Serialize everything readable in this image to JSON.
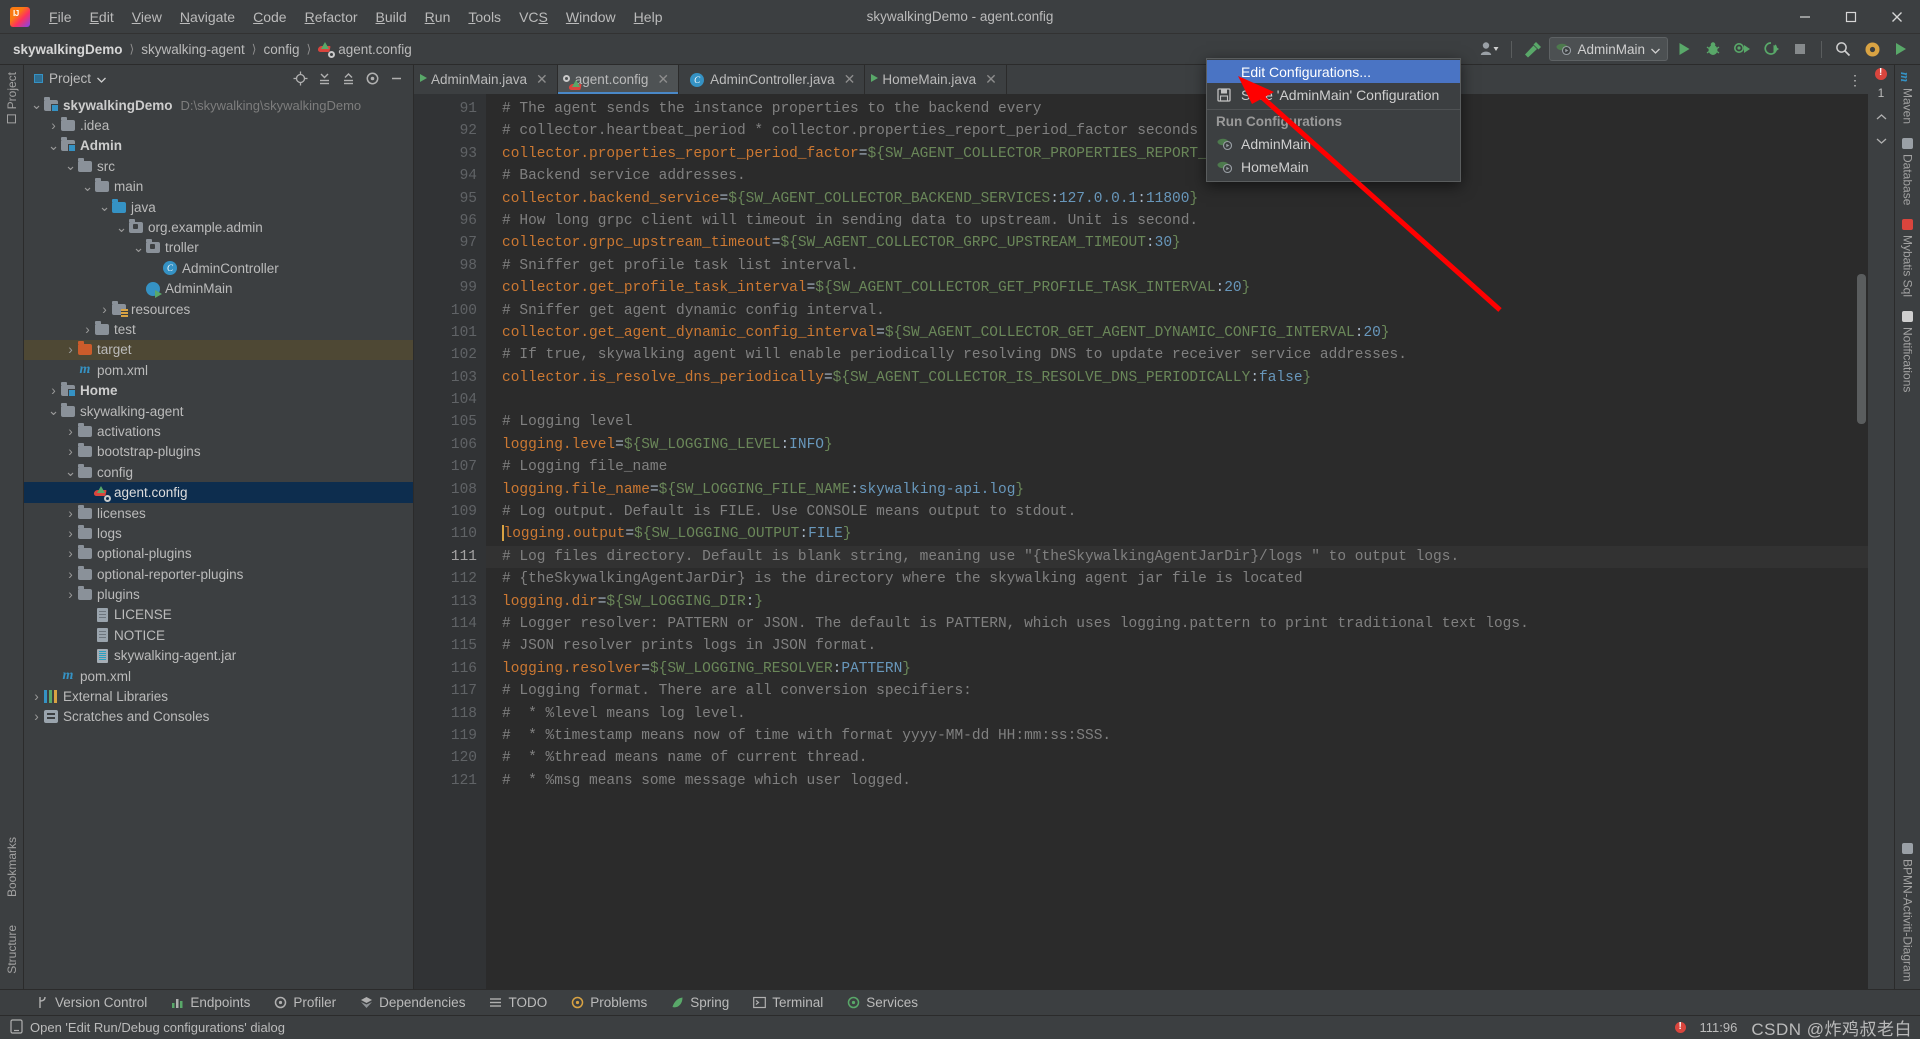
{
  "window": {
    "title": "skywalkingDemo - agent.config",
    "controls": {
      "minimize": "—",
      "maximize": "❐",
      "close": "✕"
    }
  },
  "menubar": [
    {
      "label": "File"
    },
    {
      "label": "Edit"
    },
    {
      "label": "View"
    },
    {
      "label": "Navigate"
    },
    {
      "label": "Code"
    },
    {
      "label": "Refactor"
    },
    {
      "label": "Build"
    },
    {
      "label": "Run"
    },
    {
      "label": "Tools"
    },
    {
      "label": "VCS"
    },
    {
      "label": "Window"
    },
    {
      "label": "Help"
    }
  ],
  "breadcrumbs": [
    {
      "label": "skywalkingDemo",
      "bold": true
    },
    {
      "label": "skywalking-agent",
      "bold": false
    },
    {
      "label": "config",
      "bold": false
    },
    {
      "label": "agent.config",
      "bold": false,
      "icon": "agent-config-icon"
    }
  ],
  "toolbar": {
    "account_icon": "user-account-icon",
    "build_icon": "build-hammer-icon",
    "run_config_name": "AdminMain",
    "run_icon": "run-play-icon",
    "debug_icon": "debug-bug-icon",
    "run_coverage_icon": "run-coverage-icon",
    "profiler_icon": "profiler-icon",
    "stop_icon": "stop-icon",
    "search_icon": "search-everywhere-icon",
    "settings_icon": "settings-gear-icon",
    "updates_icon": "updates-icon"
  },
  "run_config_popup": {
    "edit_configurations": "Edit Configurations...",
    "save_configuration": "Save 'AdminMain' Configuration",
    "group_label": "Run Configurations",
    "items": [
      {
        "label": "AdminMain"
      },
      {
        "label": "HomeMain"
      }
    ]
  },
  "project_panel": {
    "title": "Project",
    "actions": [
      "locate-icon",
      "expand-all-icon",
      "collapse-all-icon",
      "settings-gear-icon",
      "hide-icon"
    ],
    "tree": [
      {
        "indent": 0,
        "twisty": "⌄",
        "icon": "module-folder-icon",
        "label": "skywalkingDemo",
        "bold": true,
        "sub": "D:\\skywalking\\skywalkingDemo"
      },
      {
        "indent": 1,
        "twisty": "›",
        "icon": "folder-icon",
        "label": ".idea",
        "bold": false,
        "sub": ""
      },
      {
        "indent": 1,
        "twisty": "⌄",
        "icon": "module-folder-icon",
        "label": "Admin",
        "bold": true,
        "sub": ""
      },
      {
        "indent": 2,
        "twisty": "⌄",
        "icon": "folder-icon",
        "label": "src",
        "bold": false,
        "sub": ""
      },
      {
        "indent": 3,
        "twisty": "⌄",
        "icon": "folder-icon",
        "label": "main",
        "bold": false,
        "sub": ""
      },
      {
        "indent": 4,
        "twisty": "⌄",
        "icon": "source-folder-icon",
        "label": "java",
        "bold": false,
        "sub": ""
      },
      {
        "indent": 5,
        "twisty": "⌄",
        "icon": "package-icon",
        "label": "org.example.admin",
        "bold": false,
        "sub": ""
      },
      {
        "indent": 6,
        "twisty": "⌄",
        "icon": "package-icon",
        "label": "troller",
        "bold": false,
        "sub": ""
      },
      {
        "indent": 7,
        "twisty": "",
        "icon": "java-class-icon",
        "label": "AdminController",
        "bold": false,
        "sub": ""
      },
      {
        "indent": 6,
        "twisty": "",
        "icon": "java-runnable-class-icon",
        "label": "AdminMain",
        "bold": false,
        "sub": ""
      },
      {
        "indent": 4,
        "twisty": "›",
        "icon": "resources-folder-icon",
        "label": "resources",
        "bold": false,
        "sub": ""
      },
      {
        "indent": 3,
        "twisty": "›",
        "icon": "folder-icon",
        "label": "test",
        "bold": false,
        "sub": ""
      },
      {
        "indent": 2,
        "twisty": "›",
        "icon": "target-folder-icon",
        "label": "target",
        "bold": false,
        "sub": "",
        "highlight": "olive"
      },
      {
        "indent": 2,
        "twisty": "",
        "icon": "maven-icon",
        "label": "pom.xml",
        "bold": false,
        "sub": ""
      },
      {
        "indent": 1,
        "twisty": "›",
        "icon": "module-folder-icon",
        "label": "Home",
        "bold": true,
        "sub": ""
      },
      {
        "indent": 1,
        "twisty": "⌄",
        "icon": "folder-icon",
        "label": "skywalking-agent",
        "bold": false,
        "sub": ""
      },
      {
        "indent": 2,
        "twisty": "›",
        "icon": "folder-icon",
        "label": "activations",
        "bold": false,
        "sub": ""
      },
      {
        "indent": 2,
        "twisty": "›",
        "icon": "folder-icon",
        "label": "bootstrap-plugins",
        "bold": false,
        "sub": ""
      },
      {
        "indent": 2,
        "twisty": "⌄",
        "icon": "folder-icon",
        "label": "config",
        "bold": false,
        "sub": ""
      },
      {
        "indent": 3,
        "twisty": "",
        "icon": "agent-config-icon",
        "label": "agent.config",
        "bold": false,
        "sub": "",
        "highlight": "blue"
      },
      {
        "indent": 2,
        "twisty": "›",
        "icon": "folder-icon",
        "label": "licenses",
        "bold": false,
        "sub": ""
      },
      {
        "indent": 2,
        "twisty": "›",
        "icon": "folder-icon",
        "label": "logs",
        "bold": false,
        "sub": ""
      },
      {
        "indent": 2,
        "twisty": "›",
        "icon": "folder-icon",
        "label": "optional-plugins",
        "bold": false,
        "sub": ""
      },
      {
        "indent": 2,
        "twisty": "›",
        "icon": "folder-icon",
        "label": "optional-reporter-plugins",
        "bold": false,
        "sub": ""
      },
      {
        "indent": 2,
        "twisty": "›",
        "icon": "folder-icon",
        "label": "plugins",
        "bold": false,
        "sub": ""
      },
      {
        "indent": 3,
        "twisty": "",
        "icon": "text-file-icon",
        "label": "LICENSE",
        "bold": false,
        "sub": ""
      },
      {
        "indent": 3,
        "twisty": "",
        "icon": "text-file-icon",
        "label": "NOTICE",
        "bold": false,
        "sub": ""
      },
      {
        "indent": 3,
        "twisty": "",
        "icon": "jar-file-icon",
        "label": "skywalking-agent.jar",
        "bold": false,
        "sub": ""
      },
      {
        "indent": 1,
        "twisty": "",
        "icon": "maven-icon",
        "label": "pom.xml",
        "bold": false,
        "sub": ""
      },
      {
        "indent": 0,
        "twisty": "›",
        "icon": "external-libraries-icon",
        "label": "External Libraries",
        "bold": false,
        "sub": ""
      },
      {
        "indent": 0,
        "twisty": "›",
        "icon": "scratches-icon",
        "label": "Scratches and Consoles",
        "bold": false,
        "sub": ""
      }
    ]
  },
  "editor_tabs": [
    {
      "label": "AdminMain.java",
      "icon": "java-runnable-class-icon",
      "active": false
    },
    {
      "label": "agent.config",
      "icon": "agent-config-icon",
      "active": true
    },
    {
      "label": "AdminController.java",
      "icon": "java-class-icon",
      "active": false
    },
    {
      "label": "HomeMain.java",
      "icon": "java-runnable-class-icon",
      "active": false
    }
  ],
  "editor": {
    "first_line": 91,
    "lines": [
      {
        "n": 91,
        "tokens": [
          [
            "cm",
            "# The agent sends the instance properties to the backend every"
          ]
        ]
      },
      {
        "n": 92,
        "tokens": [
          [
            "cm",
            "# collector.heartbeat_period * collector.properties_report_period_factor seconds"
          ]
        ]
      },
      {
        "n": 93,
        "tokens": [
          [
            "key",
            "collector.properties_report_period_factor"
          ],
          [
            "eq",
            "="
          ],
          [
            "var",
            "${SW_AGENT_COLLECTOR_PROPERTIES_REPORT_PERIOD_"
          ]
        ]
      },
      {
        "n": 94,
        "tokens": [
          [
            "cm",
            "# Backend service addresses."
          ]
        ]
      },
      {
        "n": 95,
        "tokens": [
          [
            "key",
            "collector.backend_service"
          ],
          [
            "eq",
            "="
          ],
          [
            "var",
            "${SW_AGENT_COLLECTOR_BACKEND_SERVICES"
          ],
          [
            "plain",
            ":"
          ],
          [
            "num",
            "127.0.0.1"
          ],
          [
            "plain",
            ":"
          ],
          [
            "num",
            "11800"
          ],
          [
            "var",
            "}"
          ]
        ]
      },
      {
        "n": 96,
        "tokens": [
          [
            "cm",
            "# How long grpc client will timeout in sending data to upstream. Unit is second."
          ]
        ]
      },
      {
        "n": 97,
        "tokens": [
          [
            "key",
            "collector.grpc_upstream_timeout"
          ],
          [
            "eq",
            "="
          ],
          [
            "var",
            "${SW_AGENT_COLLECTOR_GRPC_UPSTREAM_TIMEOUT"
          ],
          [
            "plain",
            ":"
          ],
          [
            "num",
            "30"
          ],
          [
            "var",
            "}"
          ]
        ]
      },
      {
        "n": 98,
        "tokens": [
          [
            "cm",
            "# Sniffer get profile task list interval."
          ]
        ]
      },
      {
        "n": 99,
        "tokens": [
          [
            "key",
            "collector.get_profile_task_interval"
          ],
          [
            "eq",
            "="
          ],
          [
            "var",
            "${SW_AGENT_COLLECTOR_GET_PROFILE_TASK_INTERVAL"
          ],
          [
            "plain",
            ":"
          ],
          [
            "num",
            "20"
          ],
          [
            "var",
            "}"
          ]
        ]
      },
      {
        "n": 100,
        "tokens": [
          [
            "cm",
            "# Sniffer get agent dynamic config interval."
          ]
        ]
      },
      {
        "n": 101,
        "tokens": [
          [
            "key",
            "collector.get_agent_dynamic_config_interval"
          ],
          [
            "eq",
            "="
          ],
          [
            "var",
            "${SW_AGENT_COLLECTOR_GET_AGENT_DYNAMIC_CONFIG_INTERVAL"
          ],
          [
            "plain",
            ":"
          ],
          [
            "num",
            "20"
          ],
          [
            "var",
            "}"
          ]
        ]
      },
      {
        "n": 102,
        "tokens": [
          [
            "cm",
            "# If true, skywalking agent will enable periodically resolving DNS to update receiver service addresses."
          ]
        ]
      },
      {
        "n": 103,
        "tokens": [
          [
            "key",
            "collector.is_resolve_dns_periodically"
          ],
          [
            "eq",
            "="
          ],
          [
            "var",
            "${SW_AGENT_COLLECTOR_IS_RESOLVE_DNS_PERIODICALLY"
          ],
          [
            "plain",
            ":"
          ],
          [
            "num",
            "false"
          ],
          [
            "var",
            "}"
          ]
        ]
      },
      {
        "n": 104,
        "tokens": [
          [
            "plain",
            ""
          ]
        ]
      },
      {
        "n": 105,
        "tokens": [
          [
            "cm",
            "# Logging level"
          ]
        ]
      },
      {
        "n": 106,
        "tokens": [
          [
            "key",
            "logging.level"
          ],
          [
            "eq",
            "="
          ],
          [
            "var",
            "${SW_LOGGING_LEVEL"
          ],
          [
            "plain",
            ":"
          ],
          [
            "num",
            "INFO"
          ],
          [
            "var",
            "}"
          ]
        ]
      },
      {
        "n": 107,
        "tokens": [
          [
            "cm",
            "# Logging file_name"
          ]
        ]
      },
      {
        "n": 108,
        "tokens": [
          [
            "key",
            "logging.file_name"
          ],
          [
            "eq",
            "="
          ],
          [
            "var",
            "${SW_LOGGING_FILE_NAME"
          ],
          [
            "plain",
            ":"
          ],
          [
            "num",
            "skywalking-api.log"
          ],
          [
            "var",
            "}"
          ]
        ]
      },
      {
        "n": 109,
        "tokens": [
          [
            "cm",
            "# Log output. Default is FILE. Use CONSOLE means output to stdout."
          ]
        ]
      },
      {
        "n": 110,
        "tokens": [
          [
            "key",
            "logging.output"
          ],
          [
            "eq",
            "="
          ],
          [
            "var",
            "${SW_LOGGING_OUTPUT"
          ],
          [
            "plain",
            ":"
          ],
          [
            "num",
            "FILE"
          ],
          [
            "var",
            "}"
          ]
        ]
      },
      {
        "n": 111,
        "tokens": [
          [
            "cm",
            "# Log files directory. Default is blank string, meaning use \"{theSkywalkingAgentJarDir}/logs \" to output logs."
          ]
        ],
        "current": true
      },
      {
        "n": 112,
        "tokens": [
          [
            "cm",
            "# {theSkywalkingAgentJarDir} is the directory where the skywalking agent jar file is located"
          ]
        ]
      },
      {
        "n": 113,
        "tokens": [
          [
            "key",
            "logging.dir"
          ],
          [
            "eq",
            "="
          ],
          [
            "var",
            "${SW_LOGGING_DIR"
          ],
          [
            "plain",
            ":"
          ],
          [
            "var",
            "}"
          ]
        ]
      },
      {
        "n": 114,
        "tokens": [
          [
            "cm",
            "# Logger resolver: PATTERN or JSON. The default is PATTERN, which uses logging.pattern to print traditional text logs."
          ]
        ]
      },
      {
        "n": 115,
        "tokens": [
          [
            "cm",
            "# JSON resolver prints logs in JSON format."
          ]
        ]
      },
      {
        "n": 116,
        "tokens": [
          [
            "key",
            "logging.resolver"
          ],
          [
            "eq",
            "="
          ],
          [
            "var",
            "${SW_LOGGING_RESOLVER"
          ],
          [
            "plain",
            ":"
          ],
          [
            "num",
            "PATTERN"
          ],
          [
            "var",
            "}"
          ]
        ]
      },
      {
        "n": 117,
        "tokens": [
          [
            "cm",
            "# Logging format. There are all conversion specifiers:"
          ]
        ]
      },
      {
        "n": 118,
        "tokens": [
          [
            "cm",
            "#  * %level means log level."
          ]
        ]
      },
      {
        "n": 119,
        "tokens": [
          [
            "cm",
            "#  * %timestamp means now of time with format yyyy-MM-dd HH:mm:ss:SSS."
          ]
        ]
      },
      {
        "n": 120,
        "tokens": [
          [
            "cm",
            "#  * %thread means name of current thread."
          ]
        ]
      },
      {
        "n": 121,
        "tokens": [
          [
            "cm",
            "#  * %msg means some message which user logged."
          ]
        ]
      }
    ],
    "inspection_count": "1"
  },
  "left_rail": [
    {
      "label": "Project"
    },
    {
      "label": "Bookmarks"
    },
    {
      "label": "Structure"
    }
  ],
  "right_rail": [
    {
      "label": "Maven",
      "icon": "maven-icon"
    },
    {
      "label": "Database",
      "icon": "database-icon"
    },
    {
      "label": "Mybatis Sql",
      "icon": "mybatis-icon"
    },
    {
      "label": "Notifications",
      "icon": "notifications-bell-icon"
    },
    {
      "label": "BPMN-Activiti-Diagram",
      "icon": "bpmn-diagram-icon"
    }
  ],
  "tool_windows": [
    {
      "label": "Version Control",
      "icon": "branch-icon"
    },
    {
      "label": "Endpoints",
      "icon": "endpoints-icon"
    },
    {
      "label": "Profiler",
      "icon": "profiler-icon"
    },
    {
      "label": "Dependencies",
      "icon": "dependencies-icon"
    },
    {
      "label": "TODO",
      "icon": "todo-list-icon"
    },
    {
      "label": "Problems",
      "icon": "problems-icon"
    },
    {
      "label": "Spring",
      "icon": "spring-leaf-icon"
    },
    {
      "label": "Terminal",
      "icon": "terminal-icon"
    },
    {
      "label": "Services",
      "icon": "services-icon"
    }
  ],
  "status_bar": {
    "hint_icon": "dialog-hint-icon",
    "hint_text": "Open 'Edit Run/Debug configurations' dialog",
    "caret_position": "111:96",
    "recording_icon": "record-red-dot-icon",
    "watermark": "CSDN @炸鸡叔老白"
  },
  "colors": {
    "accent_selection": "#4a74c4",
    "tree_selection": "#0d2d4e",
    "tree_highlight": "#4e4834",
    "annotation_arrow": "#ff0000",
    "editor_bg": "#2b2b2b",
    "chrome_bg": "#3c3f41"
  }
}
